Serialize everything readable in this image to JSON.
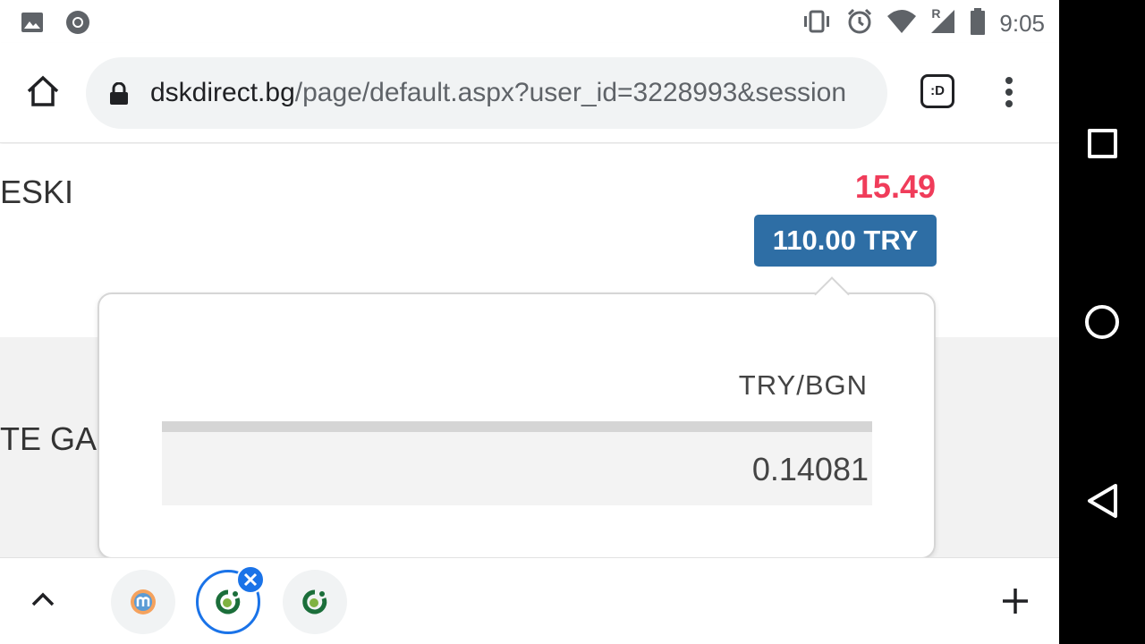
{
  "status_bar": {
    "time": "9:05",
    "left_icons": [
      "image-icon",
      "chrome-icon"
    ],
    "right_icons": [
      "vibrate-icon",
      "alarm-icon",
      "wifi-icon",
      "signal-roaming-icon",
      "battery-icon"
    ],
    "roaming_label": "R"
  },
  "toolbar": {
    "url_host": "dskdirect.bg",
    "url_path": "/page/default.aspx?user_id=3228993&session",
    "tab_switcher_label": ":D"
  },
  "page": {
    "row1_merchant": "ESKI",
    "row1_amount_bgn": "15.49",
    "row1_amount_original": "110.00 TRY",
    "row2_merchant": "TE GALA"
  },
  "popover": {
    "header": "TRY/BGN",
    "rate": "0.14081"
  },
  "colors": {
    "accent_blue": "#2e6ea5",
    "amount_red": "#f03c5a",
    "chrome_blue": "#1a73e8"
  }
}
